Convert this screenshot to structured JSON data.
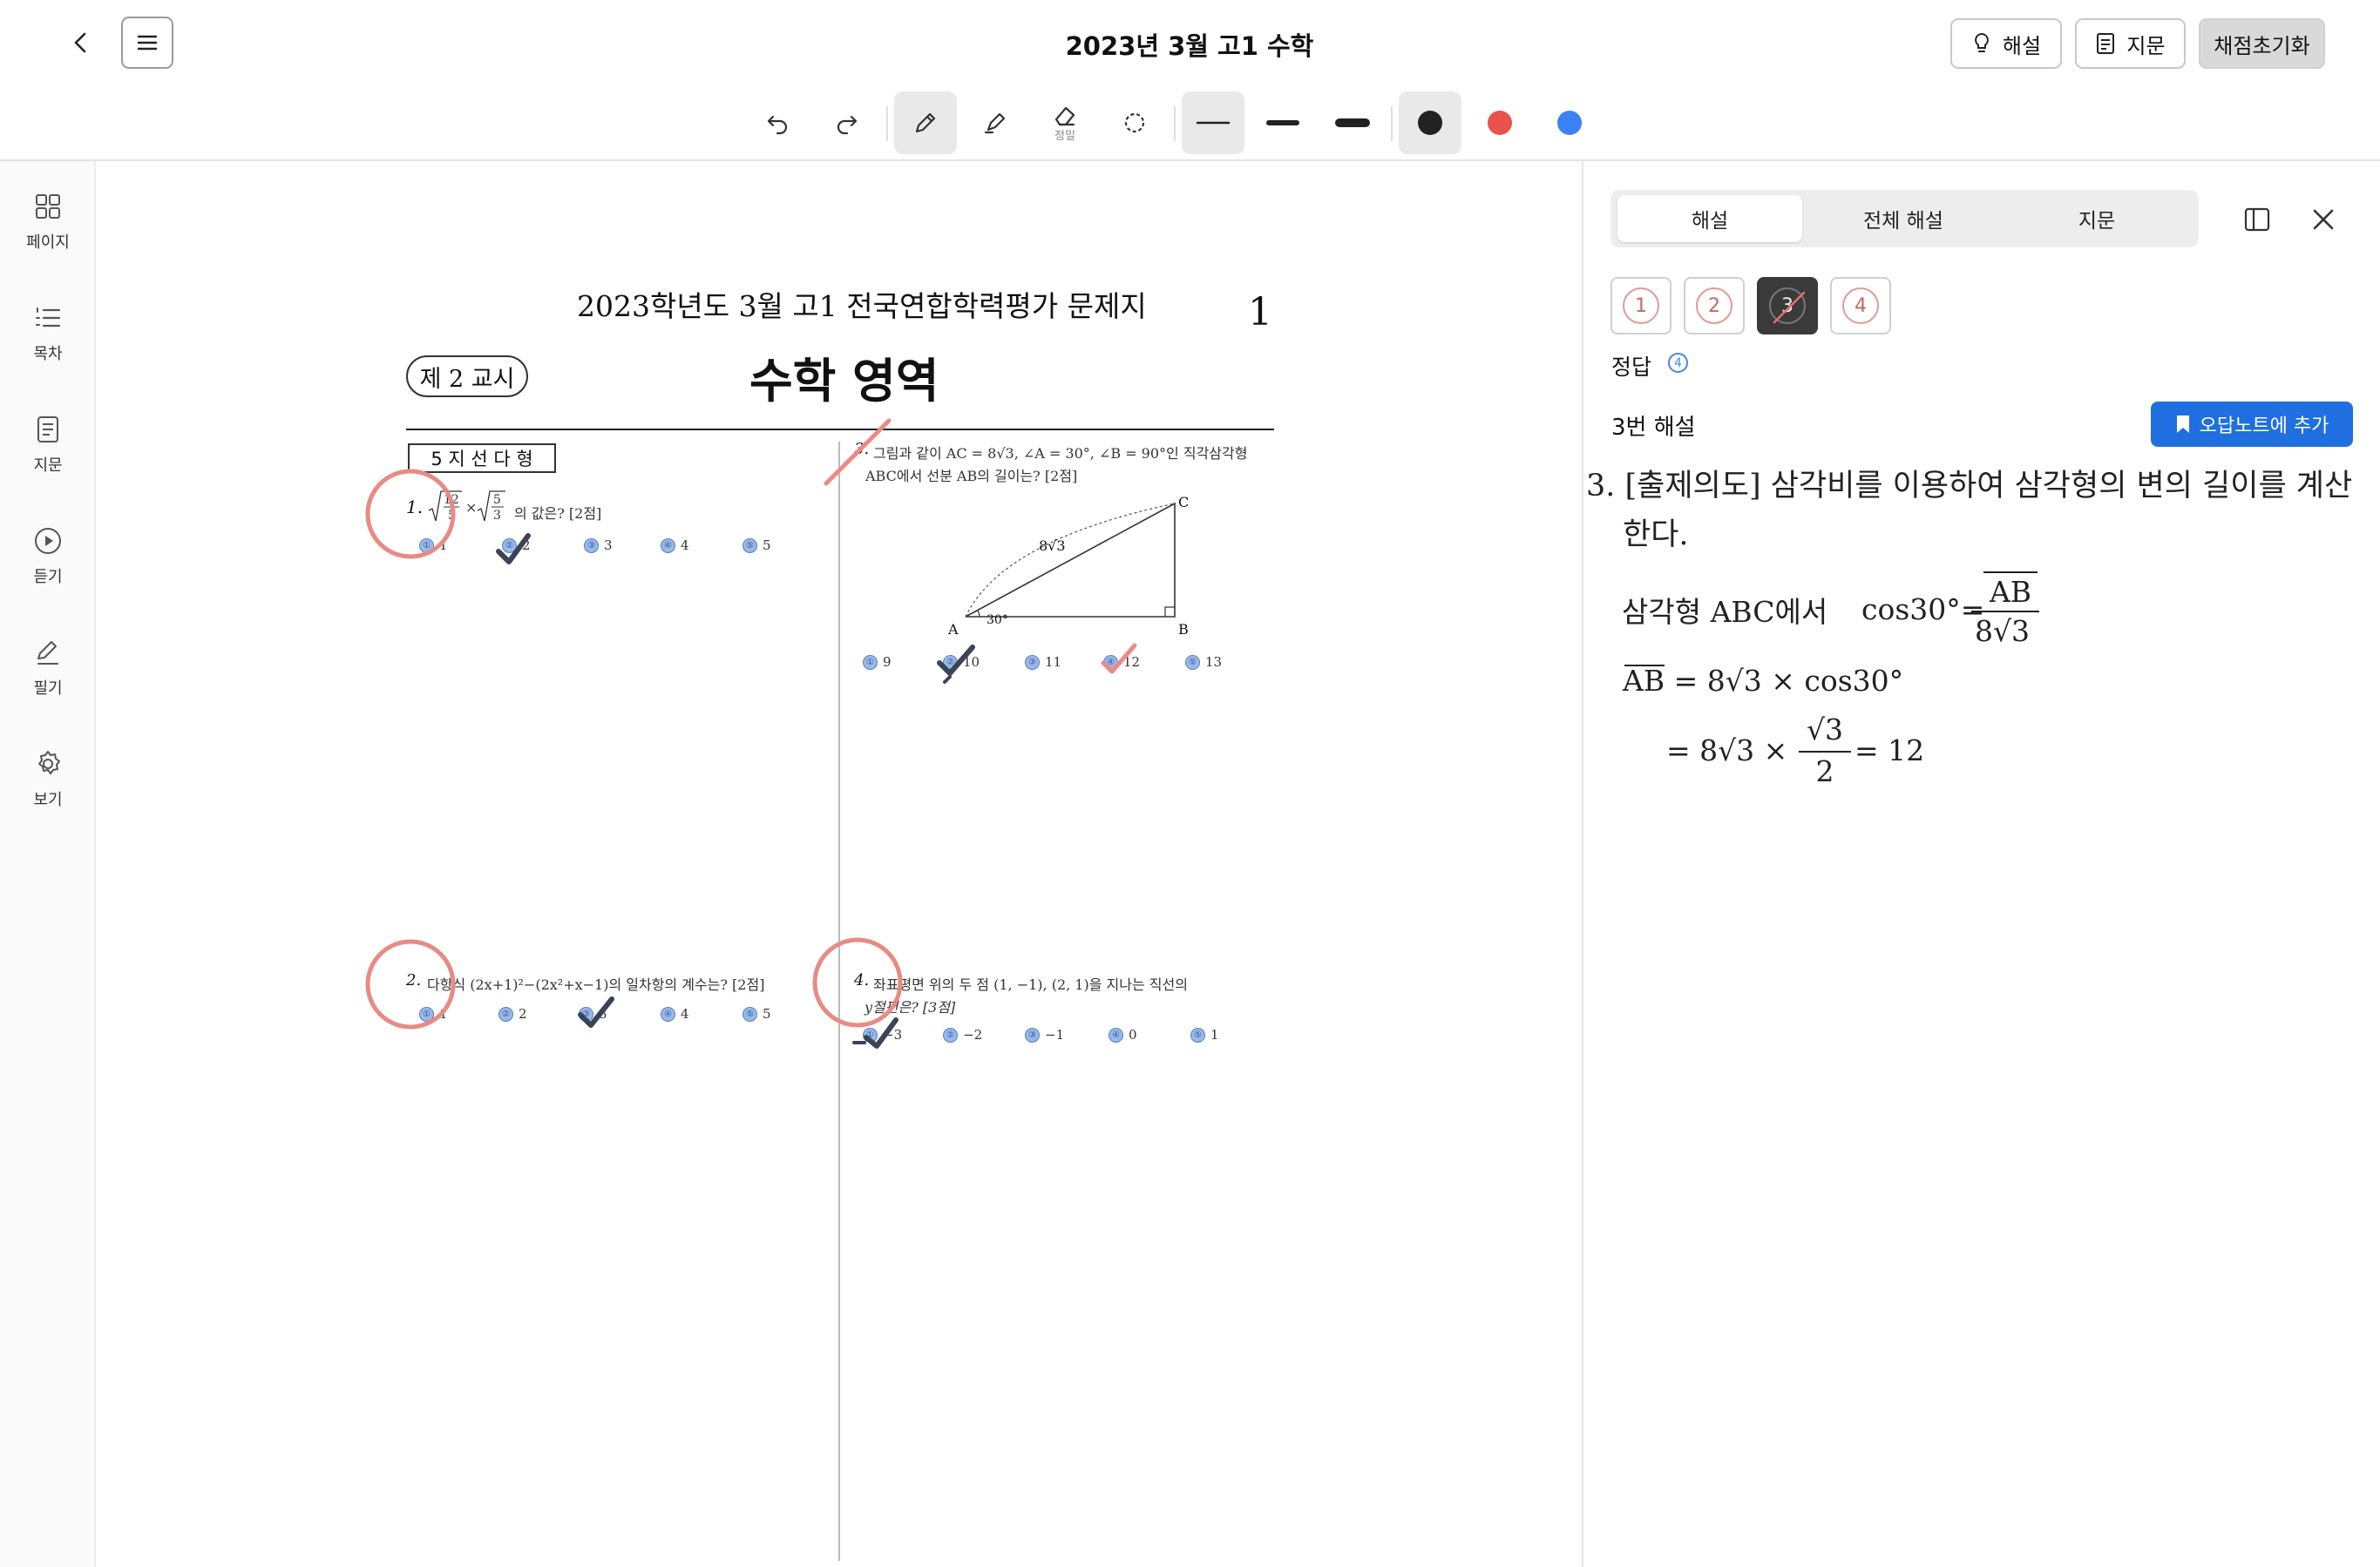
{
  "header": {
    "title": "2023년 3월 고1 수학",
    "hint_label": "해설",
    "passage_label": "지문",
    "reset_label": "채점초기화"
  },
  "toolbar": {
    "eraser_sub": "정밀",
    "colors": {
      "black": "#222222",
      "red": "#e8524a",
      "blue": "#3b82f6"
    }
  },
  "rail": {
    "items": [
      {
        "label": "페이지",
        "icon": "grid-icon"
      },
      {
        "label": "목차",
        "icon": "list-icon"
      },
      {
        "label": "지문",
        "icon": "document-icon"
      },
      {
        "label": "듣기",
        "icon": "play-icon"
      },
      {
        "label": "필기",
        "icon": "pen-icon"
      },
      {
        "label": "보기",
        "icon": "gear-icon"
      }
    ]
  },
  "exam": {
    "title": "2023학년도 3월 고1 전국연합학력평가 문제지",
    "page_number": "1",
    "period": "제 2 교시",
    "subject": "수학 영역",
    "section": "5 지 선 다 형",
    "q1": {
      "num": "1.",
      "suffix": "의 값은? [2점]",
      "choices": [
        "1",
        "2",
        "3",
        "4",
        "5"
      ]
    },
    "q2": {
      "num": "2.",
      "text": "다항식 (2x+1)²−(2x²+x−1)의 일차항의 계수는? [2점]",
      "choices": [
        "1",
        "2",
        "3",
        "4",
        "5"
      ]
    },
    "q3": {
      "num": "3.",
      "line1": "그림과 같이 AC = 8√3, ∠A = 30°, ∠B = 90°인 직각삼각형",
      "line2": "ABC에서 선분 AB의 길이는? [2점]",
      "side_label": "8√3",
      "angle_label": "30°",
      "vertex_a": "A",
      "vertex_b": "B",
      "vertex_c": "C",
      "choices": [
        "9",
        "10",
        "11",
        "12",
        "13"
      ]
    },
    "q4": {
      "num": "4.",
      "line1": "좌표평면 위의 두 점 (1, −1), (2, 1)을 지나는 직선의",
      "line2": "y절편은? [3점]",
      "choices": [
        "−3",
        "−2",
        "−1",
        "0",
        "1"
      ]
    }
  },
  "panel": {
    "tabs": [
      "해설",
      "전체 해설",
      "지문"
    ],
    "active_tab": "해설",
    "numbers": [
      "1",
      "2",
      "3",
      "4"
    ],
    "selected_number": "3",
    "answer_label": "정답",
    "answer_value": "4",
    "explanation_title": "3번 해설",
    "note_button": "오답노트에 추가",
    "explanation_text": "3. [출제의도] 삼각비를 이용하여 삼각형의 변의 길이를 계산한다.",
    "math_line1_prefix": "삼각형 ABC에서",
    "math_line1_cos": "cos30°=",
    "math_frac1_num": "AB",
    "math_frac1_den": "8√3",
    "math_line2": "AB = 8√3 × cos30°",
    "math_line3_prefix": "= 8√3 ×",
    "math_frac2_num": "√3",
    "math_frac2_den": "2",
    "math_line3_suffix": "= 12"
  }
}
